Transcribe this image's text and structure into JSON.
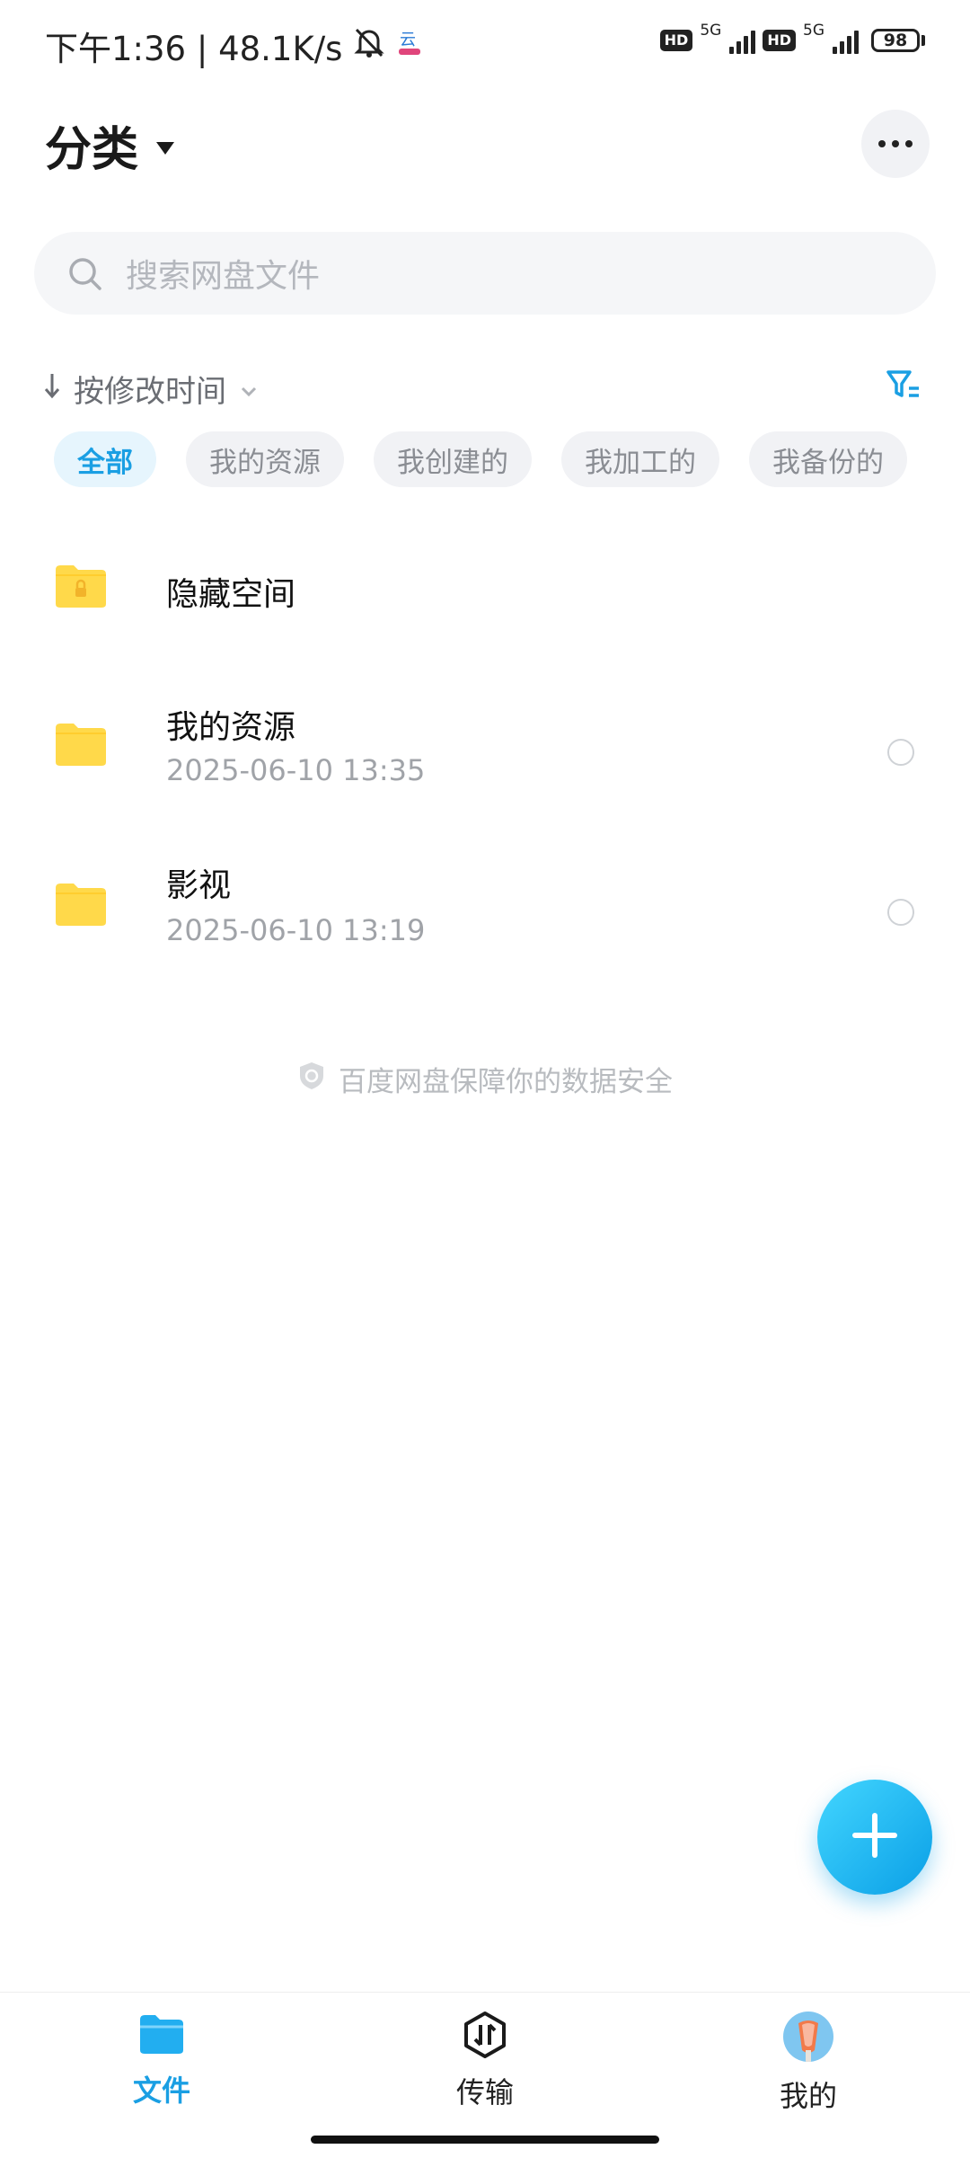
{
  "status_bar": {
    "time_speed": "下午1:36 | 48.1K/s",
    "sim1_hd": "HD",
    "sim1_network": "5G",
    "sim2_hd": "HD",
    "sim2_network": "5G",
    "battery": "98",
    "icons": [
      "mute-bell-icon",
      "cloud-app-icon",
      "signal-icon",
      "battery-icon"
    ]
  },
  "header": {
    "title": "分类",
    "dropdown_icon": "caret-down-icon",
    "more_icon": "more-dots-icon"
  },
  "search": {
    "placeholder": "搜索网盘文件"
  },
  "sort": {
    "label": "按修改时间",
    "direction_icon": "arrow-down-icon",
    "filter_icon": "filter-icon"
  },
  "chips": [
    {
      "label": "全部",
      "active": true
    },
    {
      "label": "我的资源",
      "active": false
    },
    {
      "label": "我创建的",
      "active": false
    },
    {
      "label": "我加工的",
      "active": false
    },
    {
      "label": "我备份的",
      "active": false
    }
  ],
  "files": [
    {
      "name": "隐藏空间",
      "date": "",
      "icon": "locked-folder-icon"
    },
    {
      "name": "我的资源",
      "date": "2025-06-10  13:35",
      "icon": "folder-icon"
    },
    {
      "name": "影视",
      "date": "2025-06-10  13:19",
      "icon": "folder-icon"
    }
  ],
  "footer_note": "百度网盘保障你的数据安全",
  "colors": {
    "accent": "#1a9fe3",
    "folder": "#ffd94a",
    "chip_bg": "#f1f2f5"
  },
  "bottom_nav": [
    {
      "label": "文件",
      "icon": "folder-tab-icon",
      "active": true
    },
    {
      "label": "传输",
      "icon": "transfer-icon",
      "active": false
    },
    {
      "label": "我的",
      "icon": "avatar-icon",
      "active": false
    }
  ]
}
